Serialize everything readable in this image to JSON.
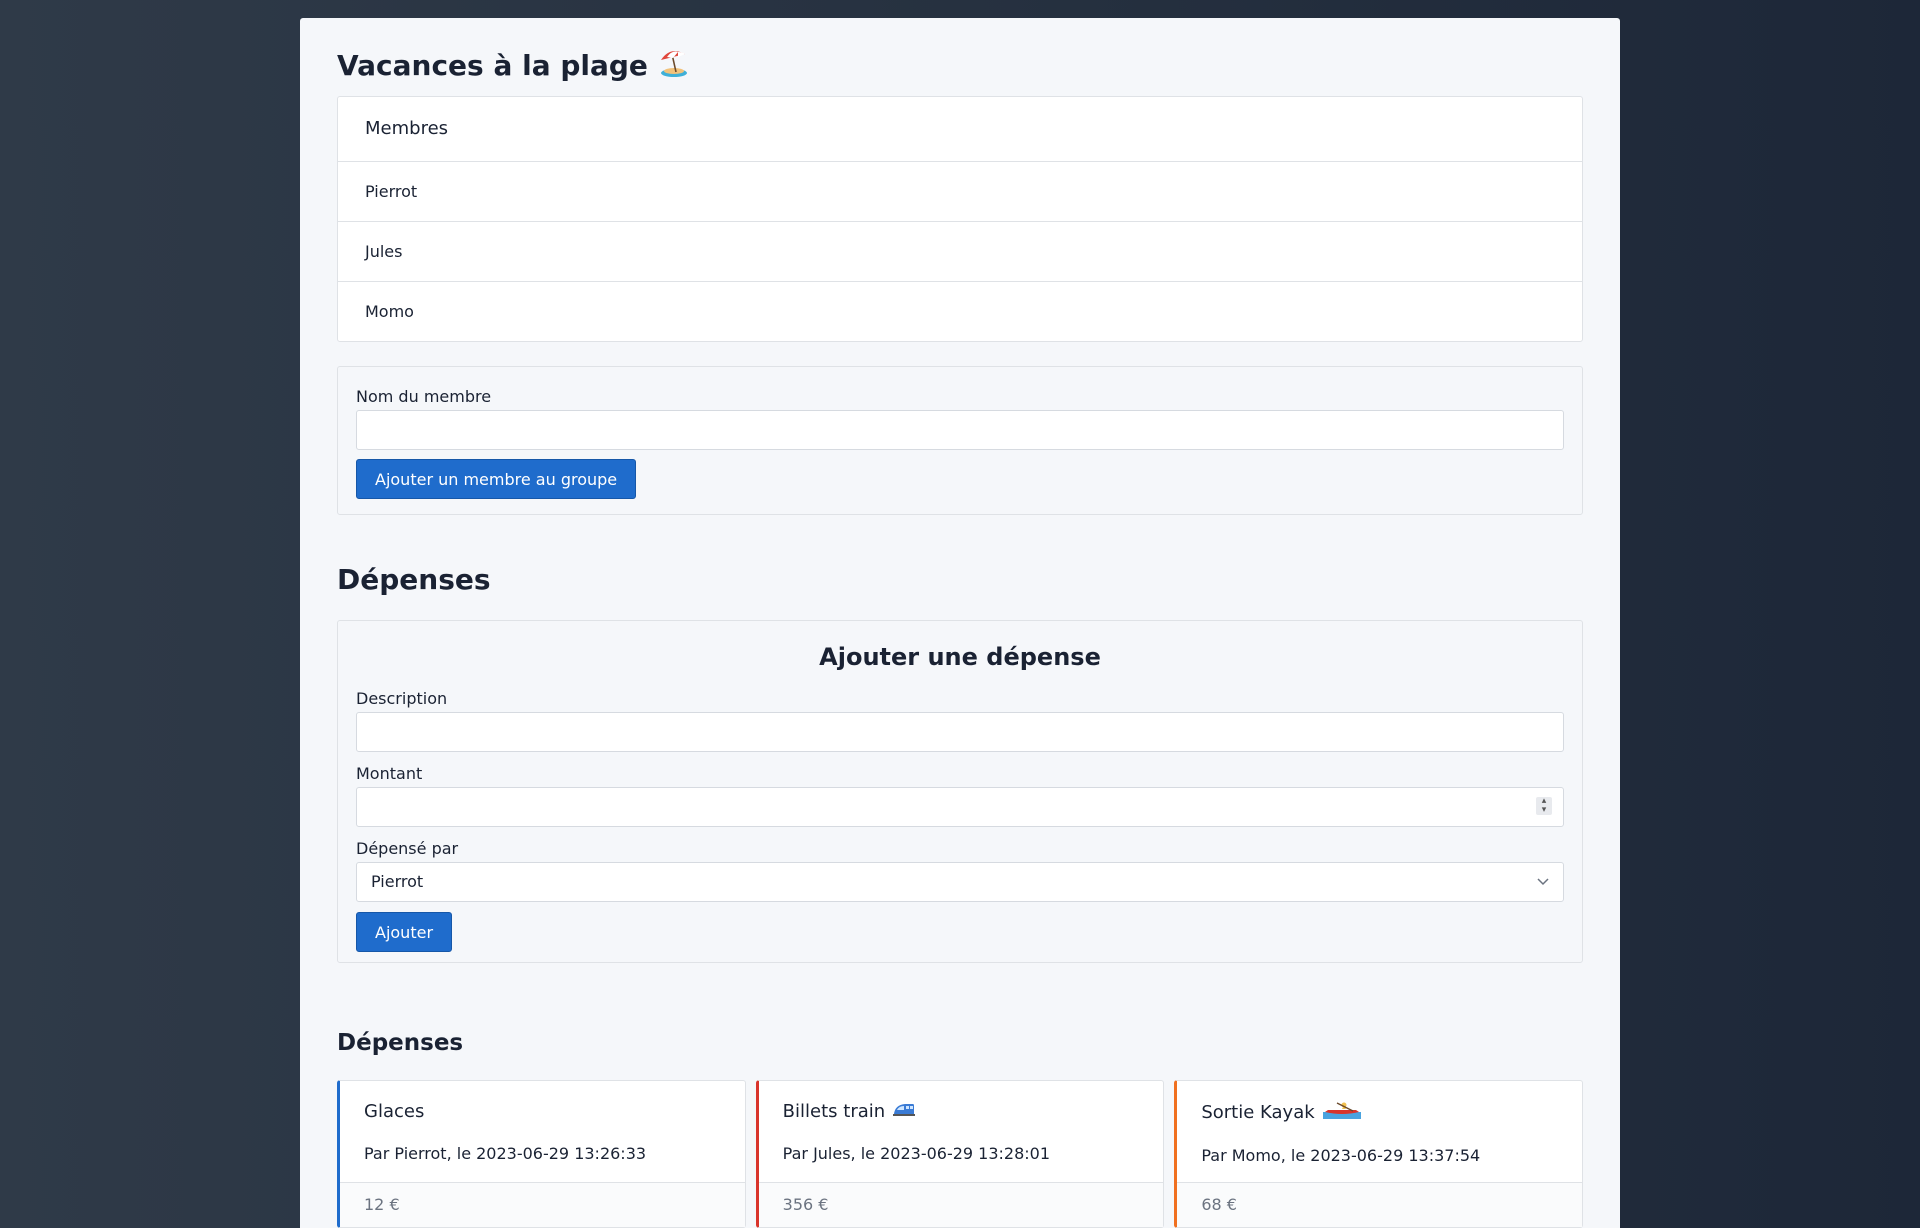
{
  "group": {
    "title": "Vacances à la plage",
    "title_icon": "beach-umbrella-icon"
  },
  "members": {
    "header": "Membres",
    "items": [
      "Pierrot",
      "Jules",
      "Momo"
    ]
  },
  "add_member": {
    "label": "Nom du membre",
    "value": "",
    "button_label": "Ajouter un membre au groupe"
  },
  "expenses_section": {
    "title": "Dépenses"
  },
  "add_expense": {
    "title": "Ajouter une dépense",
    "description_label": "Description",
    "description_value": "",
    "amount_label": "Montant",
    "amount_value": "",
    "spent_by_label": "Dépensé par",
    "spent_by_value": "Pierrot",
    "spent_by_options": [
      "Pierrot",
      "Jules",
      "Momo"
    ],
    "button_label": "Ajouter"
  },
  "expenses_list": {
    "title": "Dépenses",
    "items": [
      {
        "title": "Glaces",
        "icon": "",
        "meta": "Par Pierrot, le 2023-06-29 13:26:33",
        "amount": "12 €",
        "accent": "#1f6ccc"
      },
      {
        "title": "Billets train",
        "icon": "train-icon",
        "meta": "Par Jules, le 2023-06-29 13:28:01",
        "amount": "356 €",
        "accent": "#d9342b"
      },
      {
        "title": "Sortie Kayak",
        "icon": "kayak-icon",
        "meta": "Par Momo, le 2023-06-29 13:37:54",
        "amount": "68 €",
        "accent": "#f07020"
      }
    ]
  }
}
